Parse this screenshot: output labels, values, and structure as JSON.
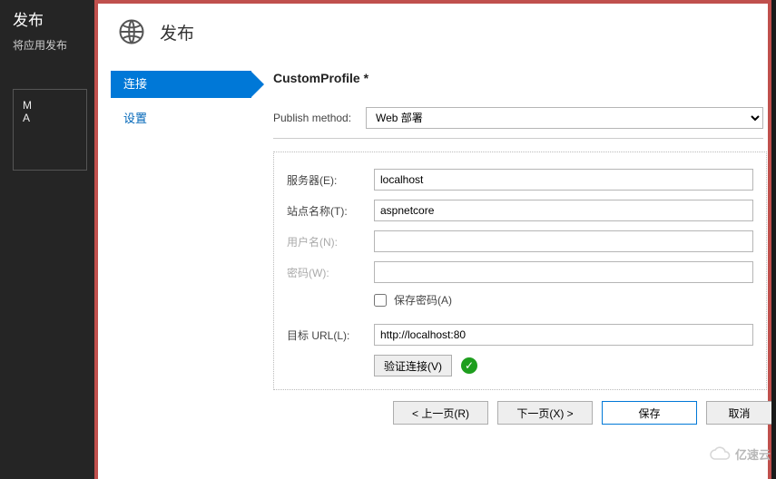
{
  "background": {
    "title": "发布",
    "subtitle": "将应用发布",
    "card_line1": "M",
    "card_line2": "A"
  },
  "dialog": {
    "title": "发布",
    "nav": {
      "connect": "连接",
      "settings": "设置"
    },
    "profile_title": "CustomProfile *",
    "publish_method_label": "Publish method:",
    "publish_method_value": "Web 部署",
    "labels": {
      "server": "服务器(E):",
      "site": "站点名称(T):",
      "user": "用户名(N):",
      "password": "密码(W):",
      "save_pw": "保存密码(A)",
      "dest_url": "目标 URL(L):"
    },
    "values": {
      "server": "localhost",
      "site": "aspnetcore",
      "user": "",
      "password": "",
      "dest_url": "http://localhost:80"
    },
    "validate_btn": "验证连接(V)",
    "footer": {
      "prev": "< 上一页(R)",
      "next": "下一页(X) >",
      "save": "保存",
      "cancel": "取消"
    }
  },
  "watermark": "亿速云"
}
